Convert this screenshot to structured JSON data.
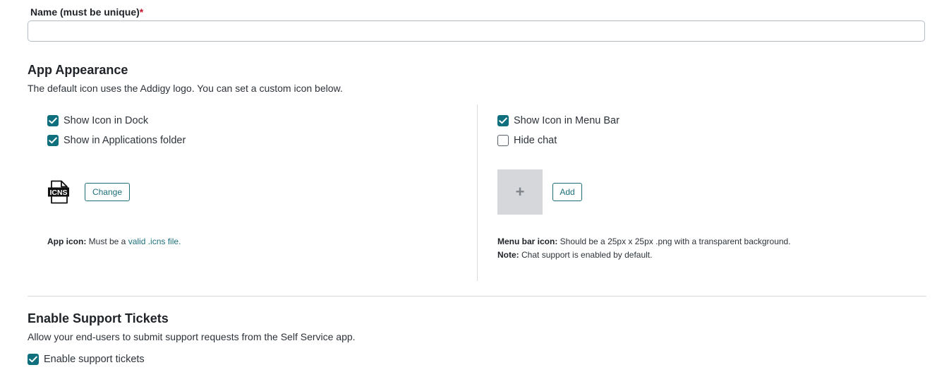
{
  "name_field": {
    "label": "Name (must be unique)",
    "required_mark": "*",
    "value": "",
    "placeholder": ""
  },
  "app_appearance": {
    "title": "App Appearance",
    "description": "The default icon uses the Addigy logo. You can set a custom icon below.",
    "left": {
      "checkboxes": [
        {
          "label": "Show Icon in Dock",
          "checked": true
        },
        {
          "label": "Show in Applications folder",
          "checked": true
        }
      ],
      "icon_name": "icns-file-icon",
      "change_button": "Change",
      "help_bold": "App icon:",
      "help_text": " Must be a ",
      "help_link": "valid .icns file."
    },
    "right": {
      "checkboxes": [
        {
          "label": "Show Icon in Menu Bar",
          "checked": true
        },
        {
          "label": "Hide chat",
          "checked": false
        }
      ],
      "placeholder_symbol": "+",
      "add_button": "Add",
      "help_bold": "Menu bar icon:",
      "help_text": " Should be a 25px x 25px .png with a transparent background.",
      "note_bold": "Note:",
      "note_text": " Chat support is enabled by default."
    }
  },
  "support_tickets": {
    "title": "Enable Support Tickets",
    "description": "Allow your end-users to submit support requests from the Self Service app.",
    "checkbox": {
      "label": "Enable support tickets",
      "checked": true
    }
  },
  "colors": {
    "accent": "#0f6f7d",
    "required": "#c8102e",
    "placeholder_bg": "#d5d7da"
  }
}
